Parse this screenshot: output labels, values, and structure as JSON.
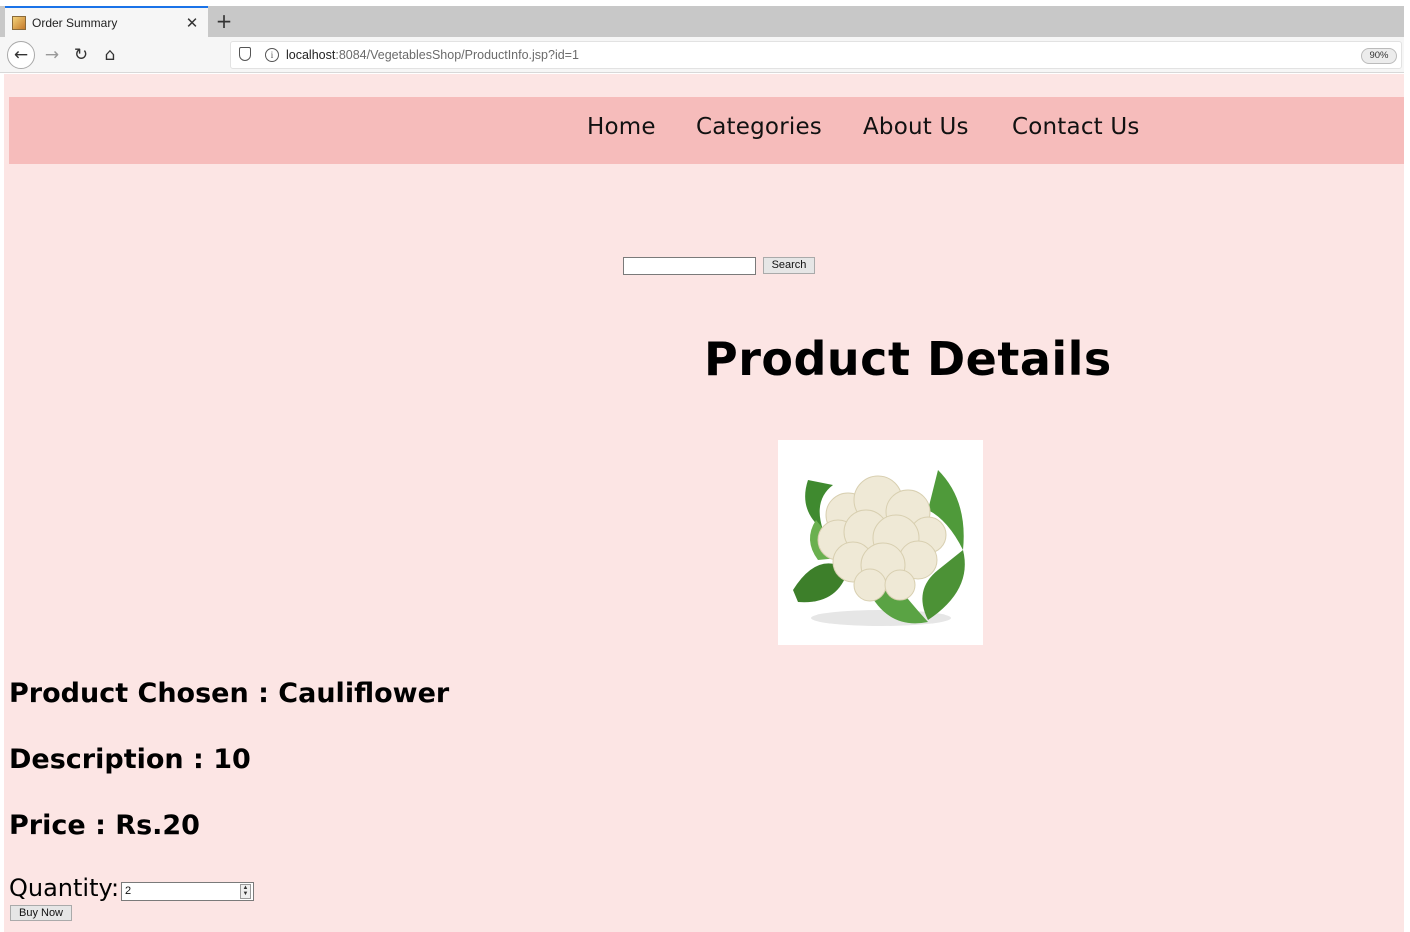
{
  "browser": {
    "tab_title": "Order Summary",
    "url_host": "localhost",
    "url_path": ":8084/VegetablesShop/ProductInfo.jsp?id=1",
    "zoom": "90%"
  },
  "site_nav": {
    "home": "Home",
    "categories": "Categories",
    "about": "About Us",
    "contact": "Contact Us"
  },
  "search": {
    "value": "",
    "button_label": "Search"
  },
  "page_title": "Product Details",
  "product": {
    "name_line": "Product Chosen : Cauliflower",
    "description_line": "Description : 10",
    "price_line": "Price : Rs.20"
  },
  "order": {
    "quantity_label": "Quantity:",
    "quantity_value": "2",
    "buy_label": "Buy Now"
  },
  "colors": {
    "page_bg": "#fce5e4",
    "nav_bg": "#f6bcbb"
  },
  "icons": {
    "favicon": "favicon-icon",
    "back": "back-arrow-icon",
    "forward": "forward-arrow-icon",
    "reload": "reload-icon",
    "home": "home-icon",
    "shield": "shield-icon",
    "info": "info-icon"
  }
}
